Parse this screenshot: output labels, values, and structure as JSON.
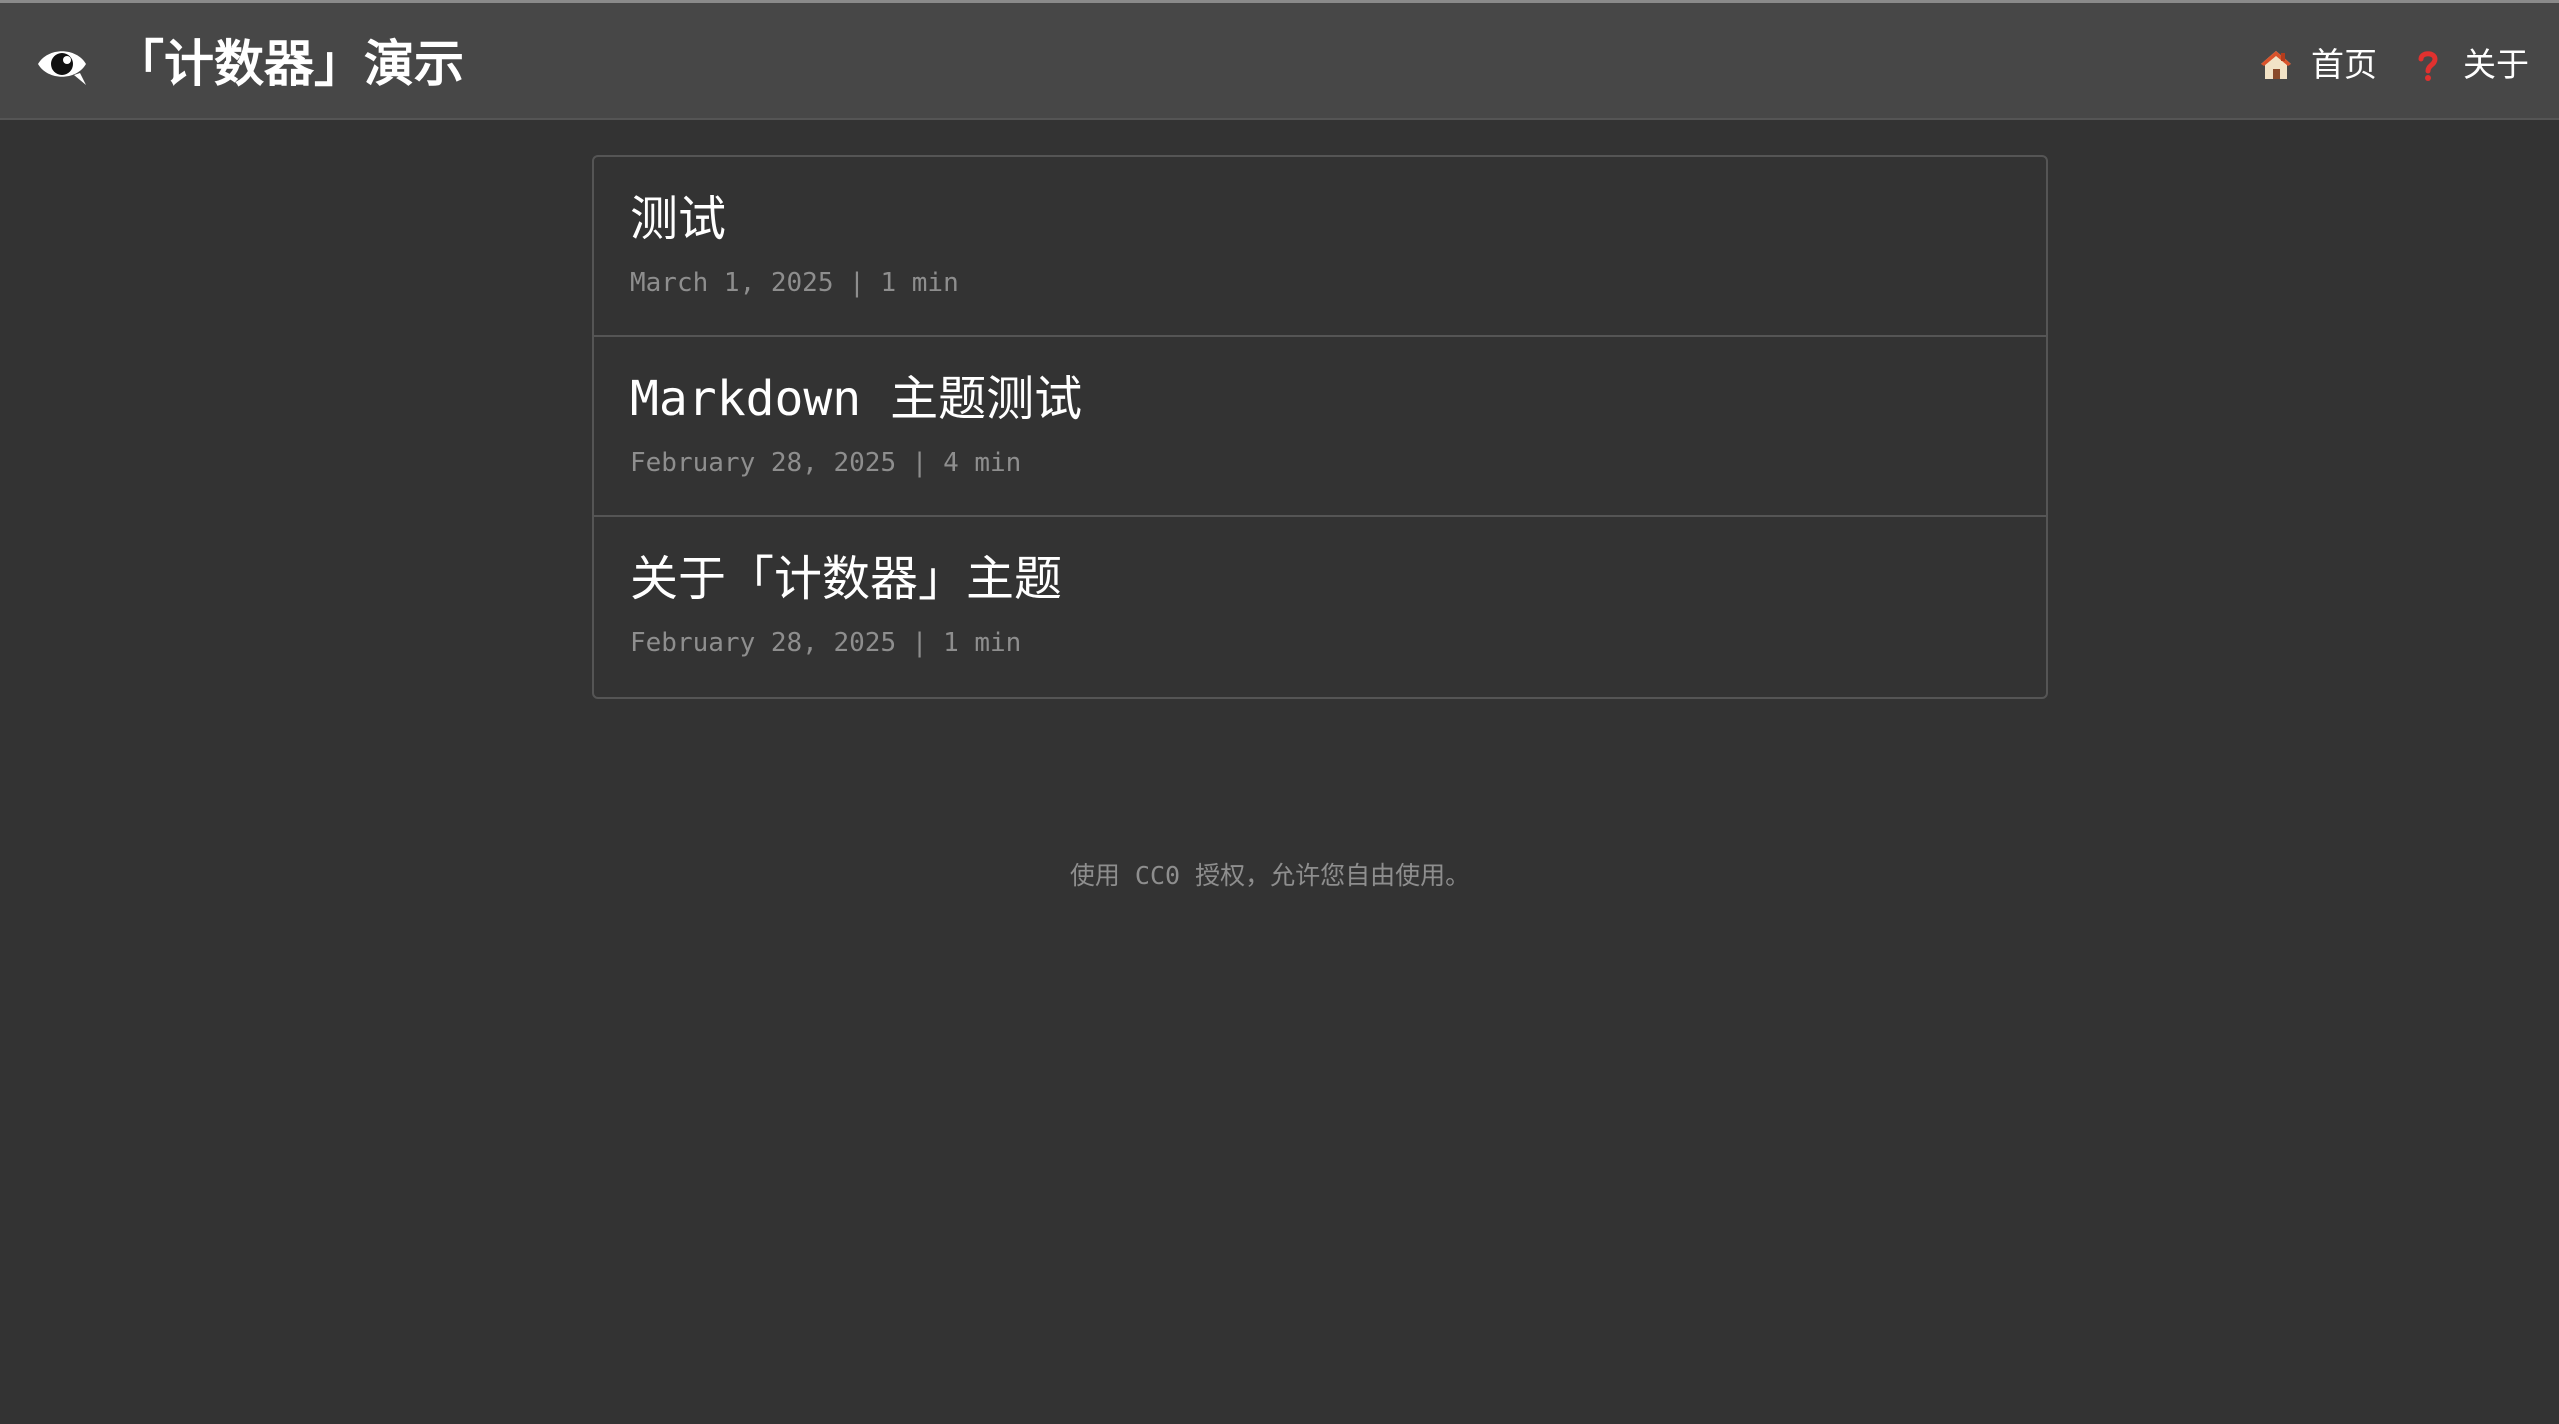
{
  "header": {
    "logo_icon": "eye-icon",
    "site_title": "「计数器」演示",
    "nav": [
      {
        "icon": "house-icon",
        "label": "首页"
      },
      {
        "icon": "question-mark-icon",
        "label": "关于"
      }
    ]
  },
  "posts": [
    {
      "title": "测试",
      "meta": "March 1, 2025 | 1 min"
    },
    {
      "title": "Markdown 主题测试",
      "meta": "February 28, 2025 | 4 min"
    },
    {
      "title": "关于「计数器」主题",
      "meta": "February 28, 2025 | 1 min"
    }
  ],
  "footer": {
    "text": "使用 CC0 授权，允许您自由使用。"
  },
  "colors": {
    "background": "#333333",
    "header": "#474747",
    "border": "#555555",
    "meta_text": "#8e8e8e"
  }
}
